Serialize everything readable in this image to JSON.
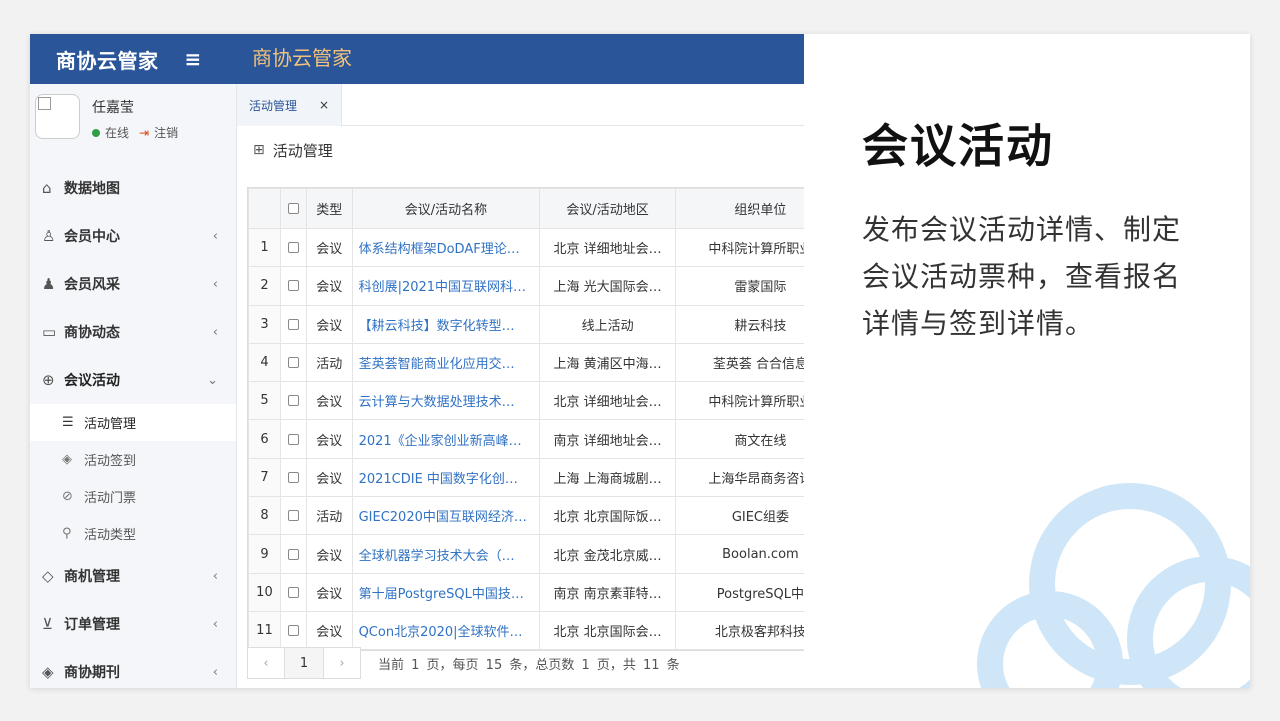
{
  "app": {
    "brand": "商协云管家",
    "top_title": "商协云管家"
  },
  "user": {
    "name": "任嘉莹",
    "status": "在线",
    "logout": "注销"
  },
  "sidebar": {
    "items": [
      {
        "label": "数据地图",
        "icon": "home-icon"
      },
      {
        "label": "会员中心",
        "icon": "user-icon"
      },
      {
        "label": "会员风采",
        "icon": "user-group-icon"
      },
      {
        "label": "商协动态",
        "icon": "message-icon"
      },
      {
        "label": "会议活动",
        "icon": "globe-icon"
      },
      {
        "label": "商机管理",
        "icon": "diamond-icon"
      },
      {
        "label": "订单管理",
        "icon": "cart-icon"
      },
      {
        "label": "商协期刊",
        "icon": "layers-icon"
      }
    ],
    "sub_items": [
      {
        "label": "活动管理",
        "icon": "list-icon"
      },
      {
        "label": "活动签到",
        "icon": "layers-icon"
      },
      {
        "label": "活动门票",
        "icon": "compass-icon"
      },
      {
        "label": "活动类型",
        "icon": "tag-icon"
      }
    ]
  },
  "tabs": [
    {
      "label": "活动管理",
      "close": "×"
    }
  ],
  "page_title": "活动管理",
  "table": {
    "headers": [
      "",
      "",
      "类型",
      "会议/活动名称",
      "会议/活动地区",
      "组织单位"
    ],
    "rows": [
      {
        "no": "1",
        "type": "会议",
        "name": "体系结构框架DoDAF理论…",
        "region": "北京 详细地址会…",
        "org": "中科院计算所职业"
      },
      {
        "no": "2",
        "type": "会议",
        "name": "科创展|2021中国互联网科…",
        "region": "上海 光大国际会…",
        "org": "雷蒙国际"
      },
      {
        "no": "3",
        "type": "会议",
        "name": "【耕云科技】数字化转型…",
        "region": "线上活动",
        "org": "耕云科技"
      },
      {
        "no": "4",
        "type": "活动",
        "name": "荃英荟智能商业化应用交…",
        "region": "上海 黄浦区中海…",
        "org": "荃英荟 合合信息"
      },
      {
        "no": "5",
        "type": "会议",
        "name": "云计算与大数据处理技术…",
        "region": "北京 详细地址会…",
        "org": "中科院计算所职业"
      },
      {
        "no": "6",
        "type": "会议",
        "name": "2021《企业家创业新高峰…",
        "region": "南京 详细地址会…",
        "org": "商文在线"
      },
      {
        "no": "7",
        "type": "会议",
        "name": "2021CDIE 中国数字化创…",
        "region": "上海 上海商城剧…",
        "org": "上海华昂商务咨询"
      },
      {
        "no": "8",
        "type": "活动",
        "name": "GIEC2020中国互联网经济…",
        "region": "北京 北京国际饭…",
        "org": "GIEC组委"
      },
      {
        "no": "9",
        "type": "会议",
        "name": "全球机器学习技术大会（…",
        "region": "北京 金茂北京威…",
        "org": "Boolan.com"
      },
      {
        "no": "10",
        "type": "会议",
        "name": "第十届PostgreSQL中国技…",
        "region": "南京 南京素菲特…",
        "org": "PostgreSQL中"
      },
      {
        "no": "11",
        "type": "会议",
        "name": "QCon北京2020|全球软件…",
        "region": "北京 北京国际会…",
        "org": "北京极客邦科技"
      }
    ]
  },
  "pager": {
    "prev": "‹",
    "current": "1",
    "next": "›",
    "info": "当前 1 页，每页 15 条，总页数 1 页，共 11 条"
  },
  "info_panel": {
    "title": "会议活动",
    "description": "发布会议活动详情、制定会议活动票种，查看报名详情与签到详情。"
  },
  "colors": {
    "topbar": "#2a5598",
    "accent_title": "#f1c27b",
    "link": "#3072c4",
    "online": "#2f9e44",
    "cloud": "#cfe6f8"
  }
}
